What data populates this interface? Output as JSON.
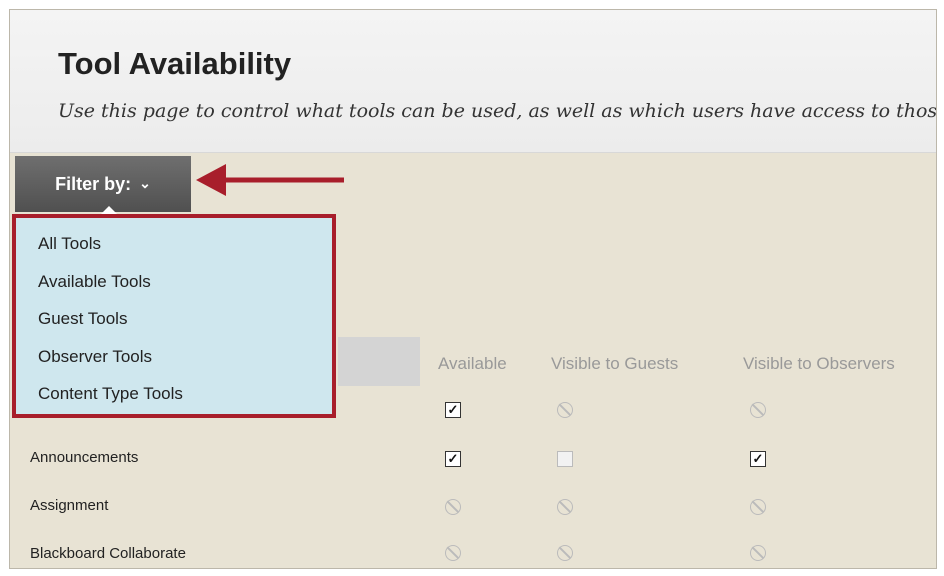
{
  "page": {
    "title": "Tool Availability",
    "subtitle": "Use this page to control what tools can be used, as well as which users have access to those to"
  },
  "filter": {
    "label": "Filter by:",
    "chevron_icon": "chevron-down-icon",
    "options": [
      "All Tools",
      "Available Tools",
      "Guest Tools",
      "Observer Tools",
      "Content Type Tools"
    ]
  },
  "table": {
    "columns": [
      "Available",
      "Visible to Guests",
      "Visible to Observers"
    ],
    "rows": [
      {
        "label": "",
        "available": "checked",
        "guests": "not-allowed",
        "observers": "not-allowed"
      },
      {
        "label": "Announcements",
        "available": "checked",
        "guests": "unchecked-disabled",
        "observers": "checked"
      },
      {
        "label": "Assignment",
        "available": "not-allowed",
        "guests": "not-allowed",
        "observers": "not-allowed"
      },
      {
        "label": "Blackboard Collaborate",
        "available": "not-allowed",
        "guests": "not-allowed",
        "observers": "not-allowed"
      }
    ]
  },
  "colors": {
    "highlight_border": "#a81e2b",
    "menu_background": "#cfe7ee",
    "filter_button": "#5a5a5a",
    "content_background": "#e8e3d4"
  }
}
